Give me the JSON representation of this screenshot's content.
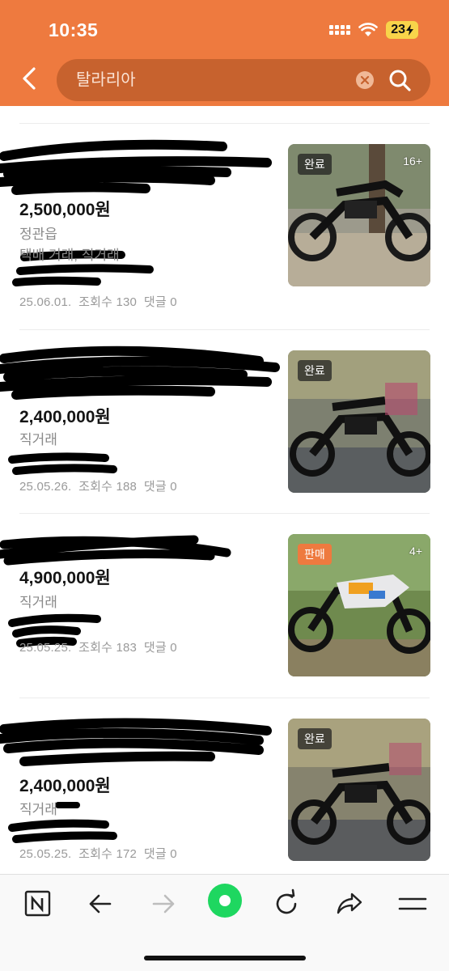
{
  "status_bar": {
    "time": "10:35",
    "battery": "23"
  },
  "search": {
    "query": "탈라리아"
  },
  "listings": [
    {
      "price": "2,500,000원",
      "location": "정관읍",
      "trade": "택배 거래, 직거래",
      "date": "25.06.01.",
      "views": "조회수 130",
      "comments": "댓글 0",
      "badge": "완료",
      "photo_count": "16+"
    },
    {
      "price": "2,400,000원",
      "trade": "직거래",
      "date": "25.05.26.",
      "views": "조회수 188",
      "comments": "댓글 0",
      "badge": "완료",
      "photo_count": ""
    },
    {
      "price": "4,900,000원",
      "trade": "직거래",
      "date": "25.05.25.",
      "views": "조회수 183",
      "comments": "댓글 0",
      "badge": "판매",
      "photo_count": "4+"
    },
    {
      "price": "2,400,000원",
      "trade": "직거래",
      "date": "25.05.25.",
      "views": "조회수 172",
      "comments": "댓글 0",
      "badge": "완료",
      "photo_count": ""
    }
  ],
  "colors": {
    "brand": "#ee7a3f",
    "search_bg": "#c7622e",
    "refresh_green": "#1ed760"
  }
}
